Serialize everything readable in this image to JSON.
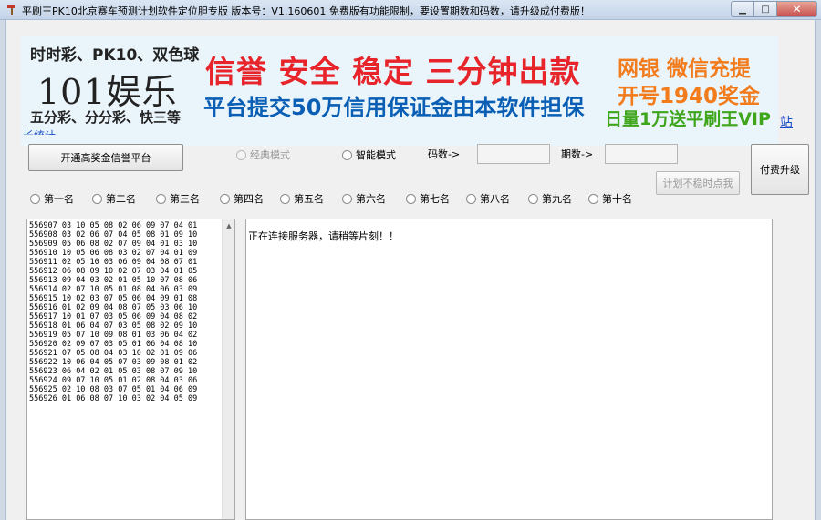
{
  "window": {
    "title": "平刷王PK10北京赛车预测计划软件定位胆专版    版本号：V1.160601      免费版有功能限制，要设置期数和码数，请升级成付费版！",
    "minimize": "▁",
    "maximize": "□",
    "close": "✕"
  },
  "banner": {
    "line1": "时时彩、PK10、双色球",
    "logo": "101娱乐",
    "line3": "五分彩、分分彩、快三等",
    "slogan_red": "信誉 安全 稳定 三分钟出款",
    "slogan_blue": "平台提交50万信用保证金由本软件担保",
    "slogan_orange1": "网银 微信充提",
    "slogan_orange2": "开号1940奖金",
    "slogan_green": "日量1万送平刷王VIP"
  },
  "links": {
    "site": "站",
    "stats": "长统计"
  },
  "controls": {
    "open_button": "开通高奖金信誉平台",
    "mode_classic": "经典模式",
    "mode_smart": "智能模式",
    "code_count_label": "码数->",
    "code_count_value": "",
    "period_count_label": "期数->",
    "period_count_value": "",
    "upgrade_button": "付费升级",
    "calc_button": "计划不稳时点我"
  },
  "positions": [
    "第一名",
    "第二名",
    "第三名",
    "第四名",
    "第五名",
    "第六名",
    "第七名",
    "第八名",
    "第九名",
    "第十名"
  ],
  "history": [
    {
      "period": "556907",
      "numbers": "03 10 05 08 02 06 09 07 04 01"
    },
    {
      "period": "556908",
      "numbers": "03 02 06 07 04 05 08 01 09 10"
    },
    {
      "period": "556909",
      "numbers": "05 06 08 02 07 09 04 01 03 10"
    },
    {
      "period": "556910",
      "numbers": "10 05 06 08 03 02 07 04 01 09"
    },
    {
      "period": "556911",
      "numbers": "02 05 10 03 06 09 04 08 07 01"
    },
    {
      "period": "556912",
      "numbers": "06 08 09 10 02 07 03 04 01 05"
    },
    {
      "period": "556913",
      "numbers": "09 04 03 02 01 05 10 07 08 06"
    },
    {
      "period": "556914",
      "numbers": "02 07 10 05 01 08 04 06 03 09"
    },
    {
      "period": "556915",
      "numbers": "10 02 03 07 05 06 04 09 01 08"
    },
    {
      "period": "556916",
      "numbers": "01 02 09 04 08 07 05 03 06 10"
    },
    {
      "period": "556917",
      "numbers": "10 01 07 03 05 06 09 04 08 02"
    },
    {
      "period": "556918",
      "numbers": "01 06 04 07 03 05 08 02 09 10"
    },
    {
      "period": "556919",
      "numbers": "05 07 10 09 08 01 03 06 04 02"
    },
    {
      "period": "556920",
      "numbers": "02 09 07 03 05 01 06 04 08 10"
    },
    {
      "period": "556921",
      "numbers": "07 05 08 04 03 10 02 01 09 06"
    },
    {
      "period": "556922",
      "numbers": "10 06 04 05 07 03 09 08 01 02"
    },
    {
      "period": "556923",
      "numbers": "06 04 02 01 05 03 08 07 09 10"
    },
    {
      "period": "556924",
      "numbers": "09 07 10 05 01 02 08 04 03 06"
    },
    {
      "period": "556925",
      "numbers": "02 10 08 03 07 05 01 04 06 09"
    },
    {
      "period": "556926",
      "numbers": "01 06 08 07 10 03 02 04 05 09"
    }
  ],
  "output": {
    "message": "正在连接服务器，请稍等片刻！！"
  },
  "icons": {
    "app": "hammer-icon"
  }
}
